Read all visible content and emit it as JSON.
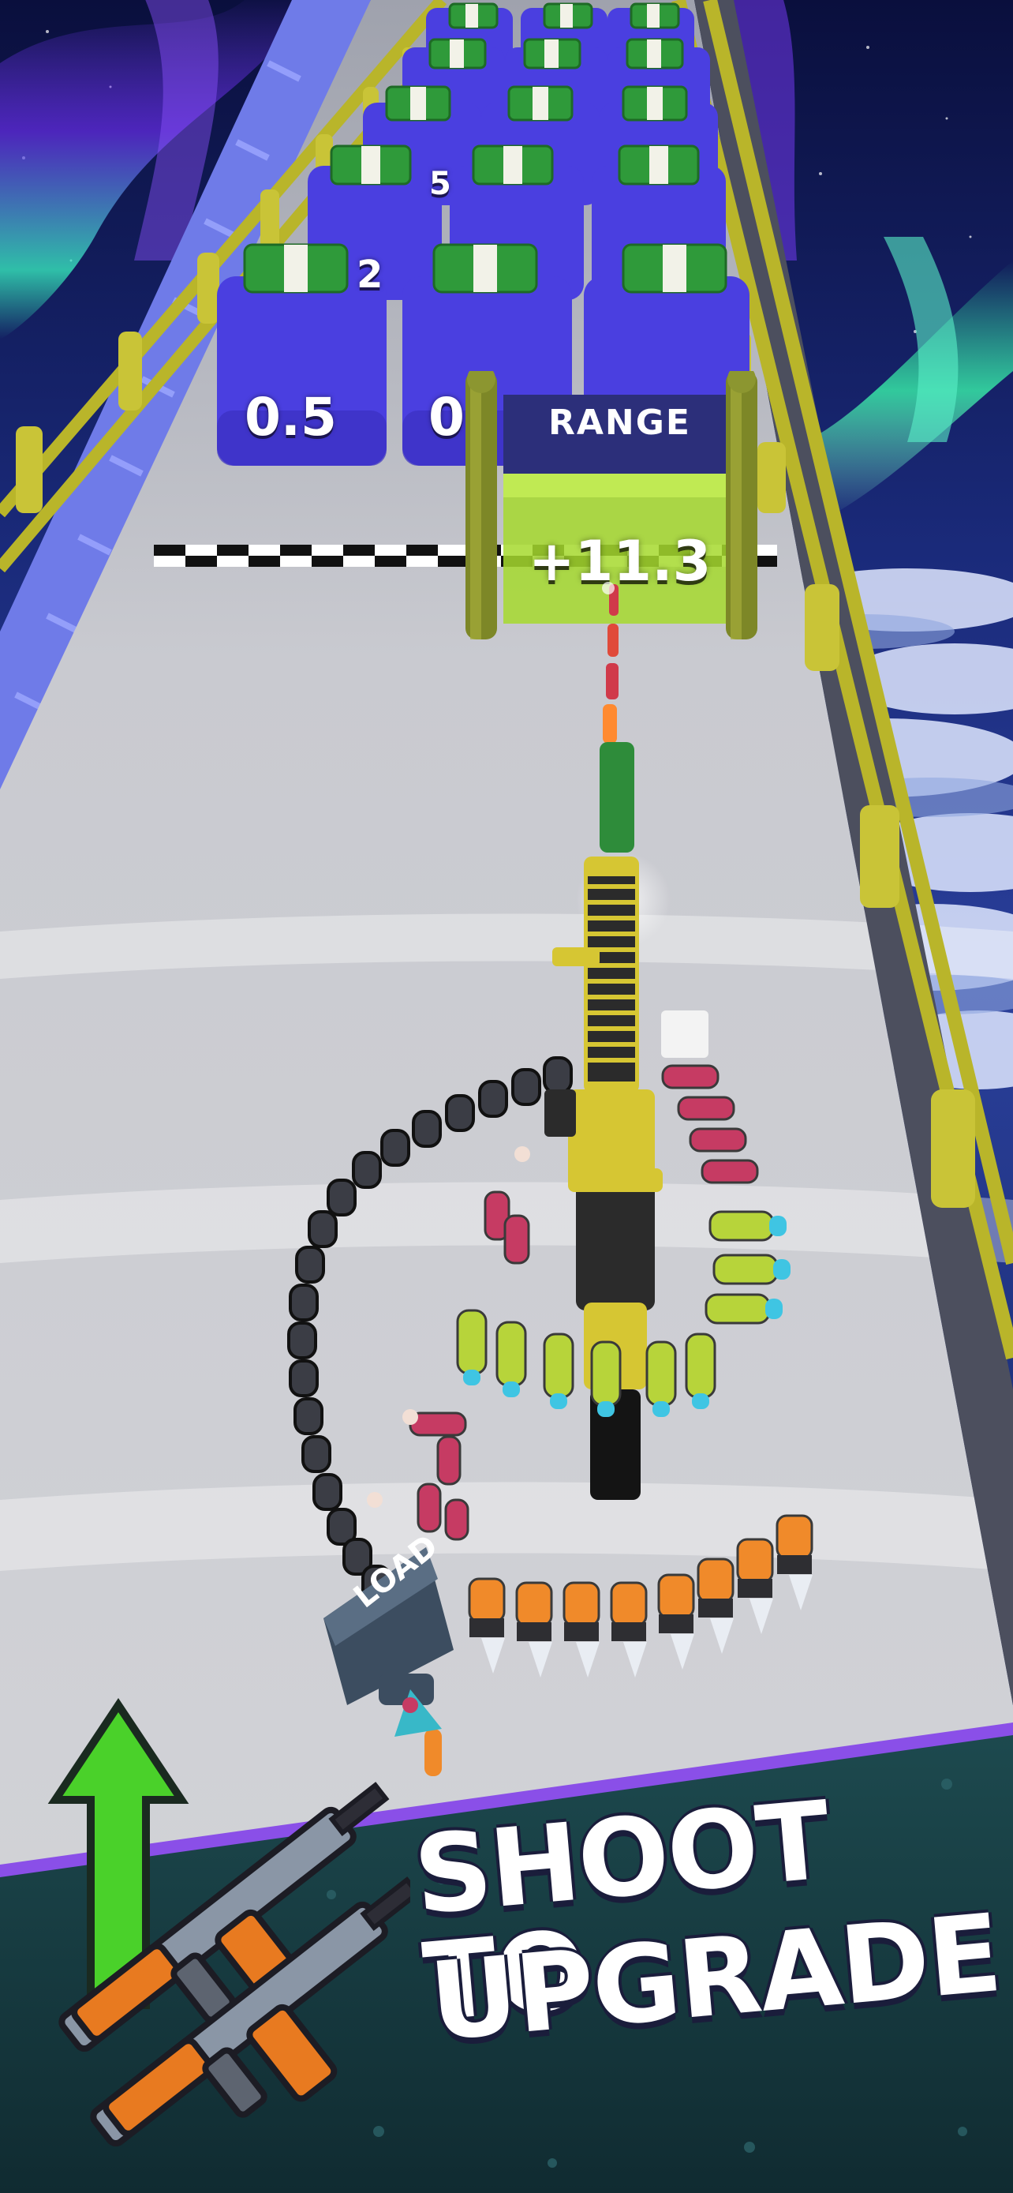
{
  "scene": {
    "multiplier_blocks": [
      "0.5",
      "0",
      "2",
      "5"
    ],
    "gate": {
      "label": "RANGE",
      "value": "+11.3"
    },
    "loader": {
      "label": "LOAD"
    }
  },
  "banner": {
    "line1": "SHOOT TO",
    "line2": "UPGRADE"
  },
  "colors": {
    "sky": "#101a5a",
    "aurora": "#3cf0c0",
    "road": "#d8d9dd",
    "rail": "#c9c437",
    "block": "#4a3fe0",
    "money": "#2f9a3a",
    "gate": "#a6d92e",
    "banner": "#173a3f",
    "accent_purple": "#8a4fe8"
  }
}
